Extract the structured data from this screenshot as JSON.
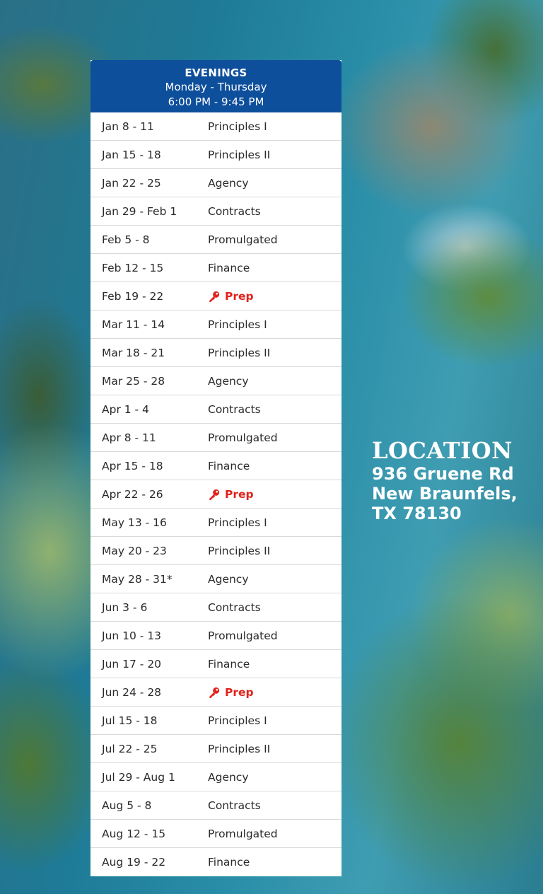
{
  "header": {
    "title": "EVENINGS",
    "days": "Monday - Thursday",
    "hours": "6:00 PM - 9:45 PM"
  },
  "rows": [
    {
      "date": "Jan 8 - 11",
      "course": "Principles I"
    },
    {
      "date": "Jan 15 - 18",
      "course": "Principles II"
    },
    {
      "date": "Jan 22 - 25",
      "course": "Agency"
    },
    {
      "date": "Jan 29 - Feb 1",
      "course": "Contracts"
    },
    {
      "date": "Feb 5 - 8",
      "course": "Promulgated"
    },
    {
      "date": "Feb 12 - 15",
      "course": "Finance"
    },
    {
      "date": "Feb 19 - 22",
      "course": "Prep"
    },
    {
      "date": "Mar 11 - 14",
      "course": "Principles I"
    },
    {
      "date": "Mar 18 - 21",
      "course": "Principles II"
    },
    {
      "date": "Mar 25 - 28",
      "course": "Agency"
    },
    {
      "date": "Apr 1 - 4",
      "course": "Contracts"
    },
    {
      "date": "Apr 8 - 11",
      "course": "Promulgated"
    },
    {
      "date": "Apr 15 - 18",
      "course": "Finance"
    },
    {
      "date": "Apr 22 - 26",
      "course": "Prep"
    },
    {
      "date": "May 13 - 16",
      "course": "Principles I"
    },
    {
      "date": "May 20 - 23",
      "course": "Principles II"
    },
    {
      "date": "May 28 - 31*",
      "course": "Agency"
    },
    {
      "date": "Jun 3 - 6",
      "course": "Contracts"
    },
    {
      "date": "Jun 10 - 13",
      "course": "Promulgated"
    },
    {
      "date": "Jun 17 - 20",
      "course": "Finance"
    },
    {
      "date": "Jun 24 - 28",
      "course": "Prep"
    },
    {
      "date": "Jul 15 - 18",
      "course": "Principles I"
    },
    {
      "date": "Jul 22 - 25",
      "course": "Principles II"
    },
    {
      "date": "Jul 29 - Aug 1",
      "course": "Agency"
    },
    {
      "date": "Aug 5 - 8",
      "course": "Contracts"
    },
    {
      "date": "Aug 12 - 15",
      "course": "Promulgated"
    },
    {
      "date": "Aug 19 - 22",
      "course": "Finance"
    }
  ],
  "location": {
    "title": "LOCATION",
    "street": "936 Gruene Rd",
    "city": "New Braunfels,",
    "state_zip": "TX 78130"
  },
  "colors": {
    "header_bg": "#0e4f9c",
    "prep_accent": "#e0231c"
  },
  "icons": {
    "prep": "key-icon"
  }
}
